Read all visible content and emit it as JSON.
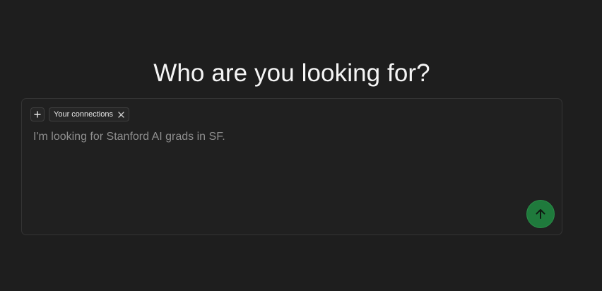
{
  "heading": "Who are you looking for?",
  "composer": {
    "chip_label": "Your connections",
    "placeholder": "I'm looking for Stanford AI grads in SF.",
    "value": ""
  },
  "icons": {
    "add": "plus-icon",
    "remove": "close-icon",
    "send": "arrow-up-icon"
  },
  "colors": {
    "background": "#1e1e1e",
    "send_button": "#1f7a3c"
  }
}
